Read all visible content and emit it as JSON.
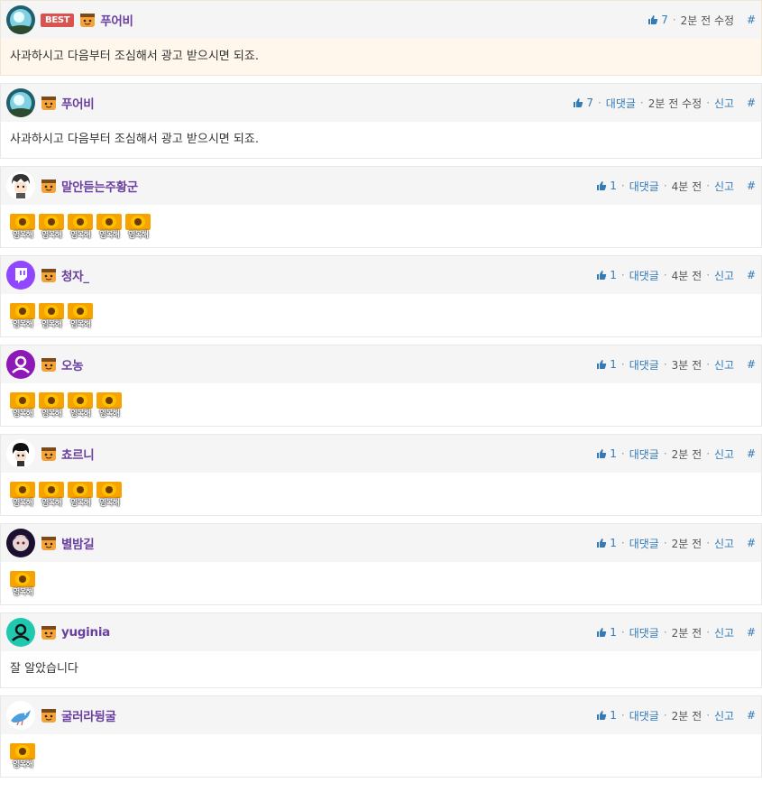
{
  "colors": {
    "nick": "#6a3fa0",
    "link": "#337ab7",
    "best_badge": "#d9534f",
    "best_bg": "#fff6ec",
    "header_bg": "#f5f5f5",
    "emote": "#f6a300"
  },
  "comments": [
    {
      "type": "best",
      "avatar": "blue-orb-avatar",
      "badge": "BEST",
      "nick": "푸어비",
      "likes": "7",
      "time": "2분 전 수정",
      "hash": "#",
      "text": "사과하시고 다음부터 조심해서 광고 받으시면 되죠."
    },
    {
      "avatar": "blue-orb-avatar",
      "nick": "푸어비",
      "likes": "7",
      "reply": "대댓글",
      "time": "2분 전 수정",
      "report": "신고",
      "hash": "#",
      "text": "사과하시고 다음부터 조심해서 광고 받으시면 되죠."
    },
    {
      "avatar": "cartoon-boy-avatar",
      "nick": "말안듣는주황군",
      "likes": "1",
      "reply": "대댓글",
      "time": "4분 전",
      "report": "신고",
      "hash": "#",
      "emote_label": "영복해",
      "emote_count": 5
    },
    {
      "avatar": "twitch-avatar",
      "nick": "청자_",
      "likes": "1",
      "reply": "대댓글",
      "time": "4분 전",
      "report": "신고",
      "hash": "#",
      "emote_label": "영복해",
      "emote_count": 3
    },
    {
      "avatar": "purple-user-avatar",
      "nick": "오농",
      "likes": "1",
      "reply": "대댓글",
      "time": "3분 전",
      "report": "신고",
      "hash": "#",
      "emote_label": "영복해",
      "emote_count": 4
    },
    {
      "avatar": "dark-hair-boy-avatar",
      "nick": "쵸르니",
      "likes": "1",
      "reply": "대댓글",
      "time": "2분 전",
      "report": "신고",
      "hash": "#",
      "emote_label": "영복해",
      "emote_count": 4
    },
    {
      "avatar": "anime-girl-avatar",
      "nick": "별밤길",
      "likes": "1",
      "reply": "대댓글",
      "time": "2분 전",
      "report": "신고",
      "hash": "#",
      "emote_label": "영복해",
      "emote_count": 1
    },
    {
      "avatar": "teal-user-avatar",
      "nick": "yuginia",
      "likes": "1",
      "reply": "대댓글",
      "time": "2분 전",
      "report": "신고",
      "hash": "#",
      "text": "잘 알았습니다"
    },
    {
      "avatar": "blue-bird-avatar",
      "nick": "굴러라뒹굴",
      "likes": "1",
      "reply": "대댓글",
      "time": "2분 전",
      "report": "신고",
      "hash": "#",
      "emote_label": "영복해",
      "emote_count": 1
    }
  ]
}
